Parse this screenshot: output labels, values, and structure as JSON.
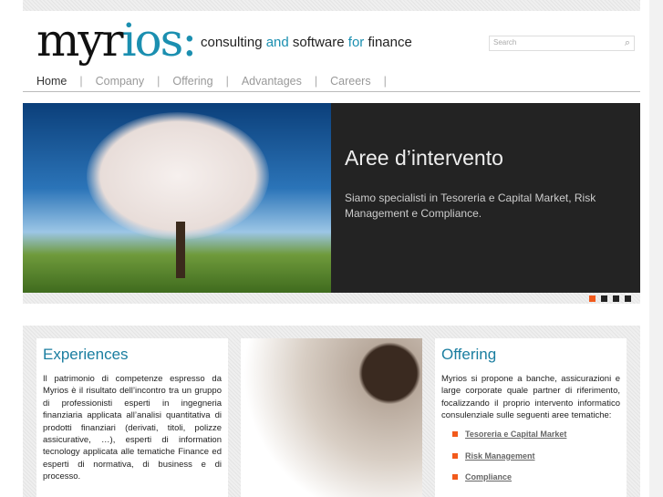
{
  "header": {
    "logo_a": "myr",
    "logo_b": "ios:",
    "tagline_1": "consulting ",
    "tagline_2": "and",
    "tagline_3": " software ",
    "tagline_4": "for",
    "tagline_5": " finance",
    "search_placeholder": "Search"
  },
  "nav": {
    "items": [
      "Home",
      "Company",
      "Offering",
      "Advantages",
      "Careers"
    ],
    "separator": "|"
  },
  "banner": {
    "title": "Aree d’intervento",
    "text": "Siamo specialisti in Tesoreria e Capital Market, Risk Management e Compliance.",
    "slides": 4,
    "active_slide": 1,
    "active_color": "#f25a1c"
  },
  "experiences": {
    "title": "Experiences",
    "text": "Il patrimonio di competenze espresso da Myrios è il risultato dell’incontro tra un gruppo di professionisti esperti in ingegneria finanziaria applicata all’analisi quantitativa di prodotti finanziari (derivati, titoli, polizze assicurative, …), esperti di information tecnology applicata alle tematiche Finance ed esperti di normativa, di business e di processo."
  },
  "offering": {
    "title": "Offering",
    "text": "Myrios si propone a banche, assicurazioni e large corporate quale partner di riferimento, focalizzando il proprio intervento informatico consulenziale sulle seguenti aree tematiche:",
    "links": [
      "Tesoreria e Capital Market",
      "Risk Management",
      "Compliance"
    ]
  }
}
